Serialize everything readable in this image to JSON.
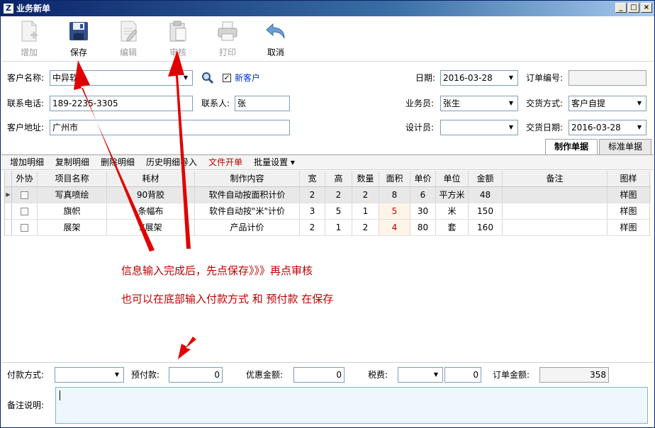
{
  "window": {
    "title": "业务新单"
  },
  "toolbar": {
    "add": "增加",
    "save": "保存",
    "edit": "编辑",
    "review": "审核",
    "print": "打印",
    "cancel": "取消"
  },
  "form": {
    "customer_name_label": "客户名称:",
    "customer_name": "中异软件",
    "new_customer_label": "新客户",
    "new_customer_checked": true,
    "phone_label": "联系电话:",
    "phone": "189-2235-3305",
    "contact_label": "联系人:",
    "contact": "张",
    "address_label": "客户地址:",
    "address": "广州市",
    "date_label": "日期:",
    "date": "2016-03-28",
    "order_no_label": "订单编号:",
    "order_no": "",
    "salesman_label": "业务员:",
    "salesman": "张生",
    "delivery_method_label": "交货方式:",
    "delivery_method": "客户自提",
    "designer_label": "设计员:",
    "designer": "",
    "delivery_date_label": "交货日期:",
    "delivery_date": "2016-03-28"
  },
  "tabs": [
    "制作单据",
    "标准单据"
  ],
  "subbar": [
    "增加明细",
    "复制明细",
    "删除明细",
    "历史明细导入",
    "文件开单",
    "批量设置 ▾"
  ],
  "grid": {
    "headers": [
      "外协",
      "项目名称",
      "耗材",
      "制作内容",
      "宽",
      "高",
      "数量",
      "面积",
      "单价",
      "单位",
      "金额",
      "备注",
      "图样"
    ],
    "rows": [
      [
        "",
        "写真喷绘",
        "90背胶",
        "软件自动按面积计价",
        "2",
        "2",
        "2",
        "8",
        "6",
        "平方米",
        "48",
        "",
        "样图"
      ],
      [
        "",
        "旗帜",
        "条幅布",
        "软件自动按\"米\"计价",
        "3",
        "5",
        "1",
        "5",
        "30",
        "米",
        "150",
        "",
        "样图"
      ],
      [
        "",
        "展架",
        "X展架",
        "产品计价",
        "2",
        "1",
        "2",
        "4",
        "80",
        "套",
        "160",
        "",
        "样图"
      ]
    ]
  },
  "annotations": {
    "line1": "信息输入完成后，先点保存》》》再点审核",
    "line2": "也可以在底部输入付款方式 和 预付款 在保存"
  },
  "bottom": {
    "payment_method_label": "付款方式:",
    "payment_method": "",
    "prepayment_label": "预付款:",
    "prepayment": "0",
    "discount_label": "优惠金额:",
    "discount": "0",
    "tax_label": "税费:",
    "tax_type": "",
    "tax": "0",
    "order_amount_label": "订单金额:",
    "order_amount": "358",
    "memo_label": "备注说明:",
    "memo": ""
  },
  "colors": {
    "accent_red": "#c00000",
    "title_blue": "#0a246a",
    "link_blue": "#0033cc"
  }
}
